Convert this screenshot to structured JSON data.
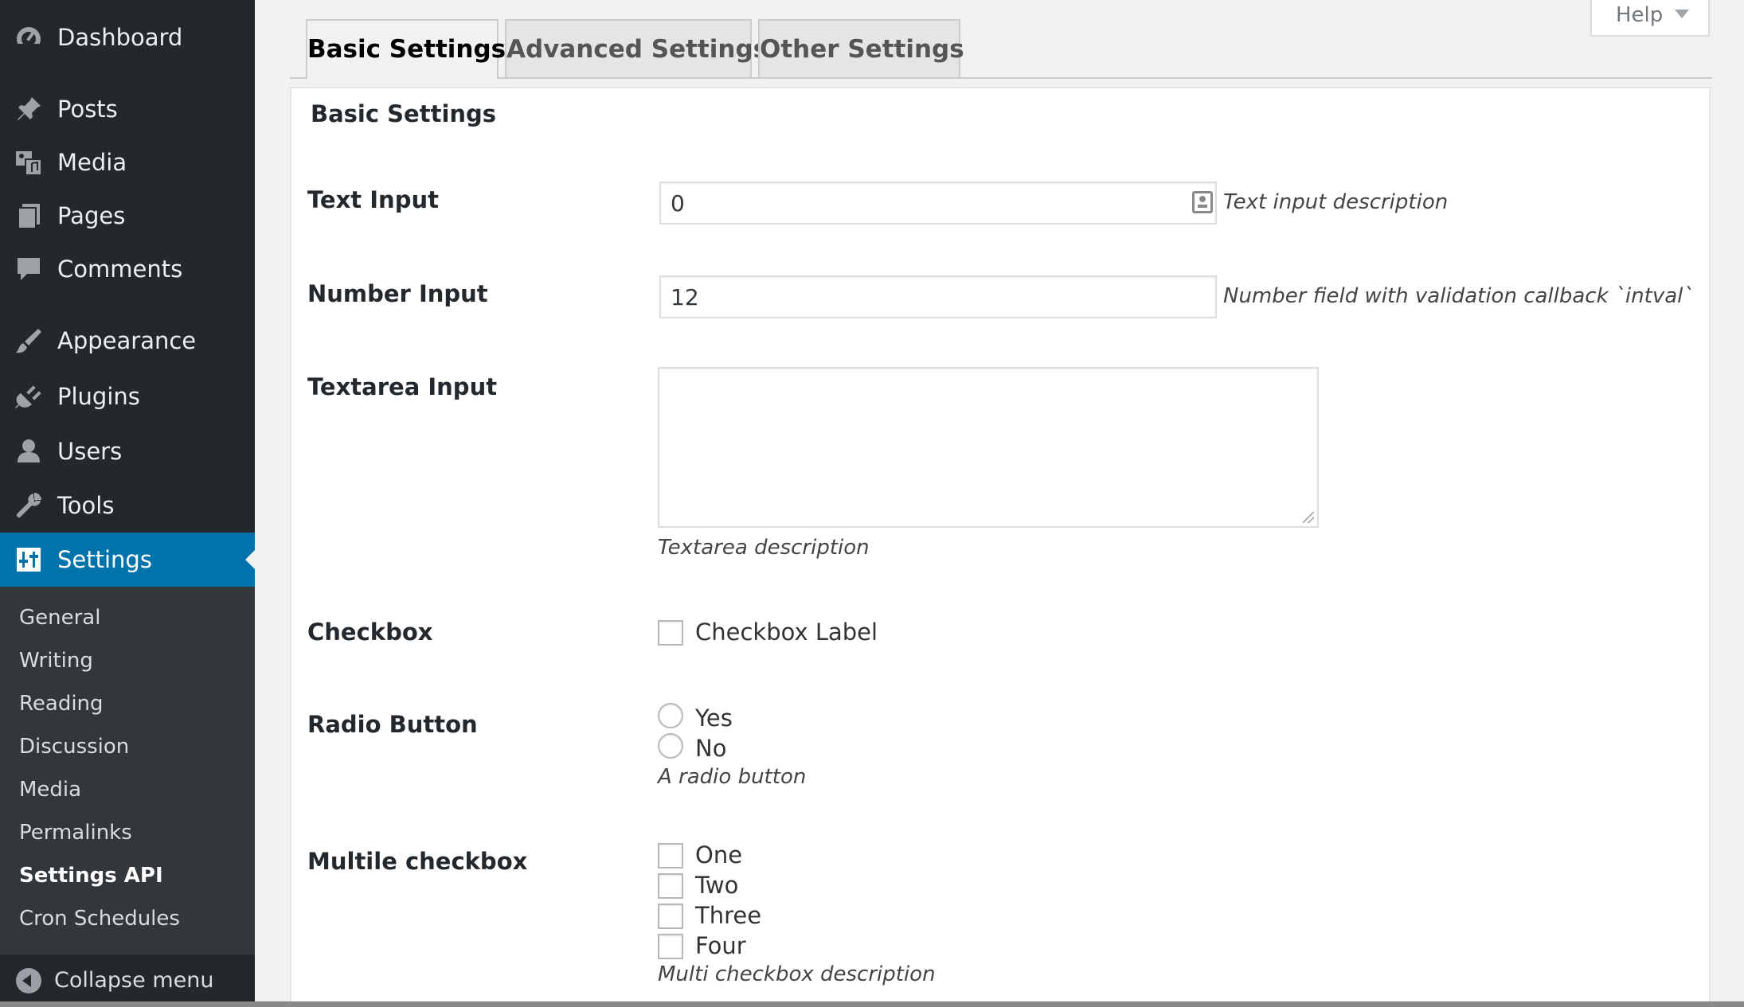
{
  "sidebar": {
    "items": [
      {
        "label": "Dashboard",
        "icon": "dashboard-icon"
      },
      {
        "label": "Posts",
        "icon": "pin-icon"
      },
      {
        "label": "Media",
        "icon": "media-icon"
      },
      {
        "label": "Pages",
        "icon": "pages-icon"
      },
      {
        "label": "Comments",
        "icon": "comment-icon"
      },
      {
        "label": "Appearance",
        "icon": "brush-icon"
      },
      {
        "label": "Plugins",
        "icon": "plug-icon"
      },
      {
        "label": "Users",
        "icon": "user-icon"
      },
      {
        "label": "Tools",
        "icon": "wrench-icon"
      },
      {
        "label": "Settings",
        "icon": "settings-icon"
      }
    ],
    "submenu": [
      "General",
      "Writing",
      "Reading",
      "Discussion",
      "Media",
      "Permalinks",
      "Settings API",
      "Cron Schedules"
    ],
    "collapse_label": "Collapse menu"
  },
  "help": {
    "label": "Help"
  },
  "tabs": [
    "Basic Settings",
    "Advanced Settings",
    "Other Settings"
  ],
  "section_title": "Basic Settings",
  "fields": {
    "text_input": {
      "label": "Text Input",
      "value": "0",
      "description": "Text input description"
    },
    "number_input": {
      "label": "Number Input",
      "value": "12",
      "description": "Number field with validation callback `intval`"
    },
    "textarea_input": {
      "label": "Textarea Input",
      "value": "",
      "description": "Textarea description"
    },
    "checkbox": {
      "label": "Checkbox",
      "option": "Checkbox Label"
    },
    "radio": {
      "label": "Radio Button",
      "options": [
        "Yes",
        "No"
      ],
      "description": "A radio button"
    },
    "multicheck": {
      "label": "Multile checkbox",
      "options": [
        "One",
        "Two",
        "Three",
        "Four"
      ],
      "description": "Multi checkbox description"
    }
  },
  "colors": {
    "sidebar": "#23282d",
    "submenu": "#32373c",
    "accent": "#0073aa"
  }
}
